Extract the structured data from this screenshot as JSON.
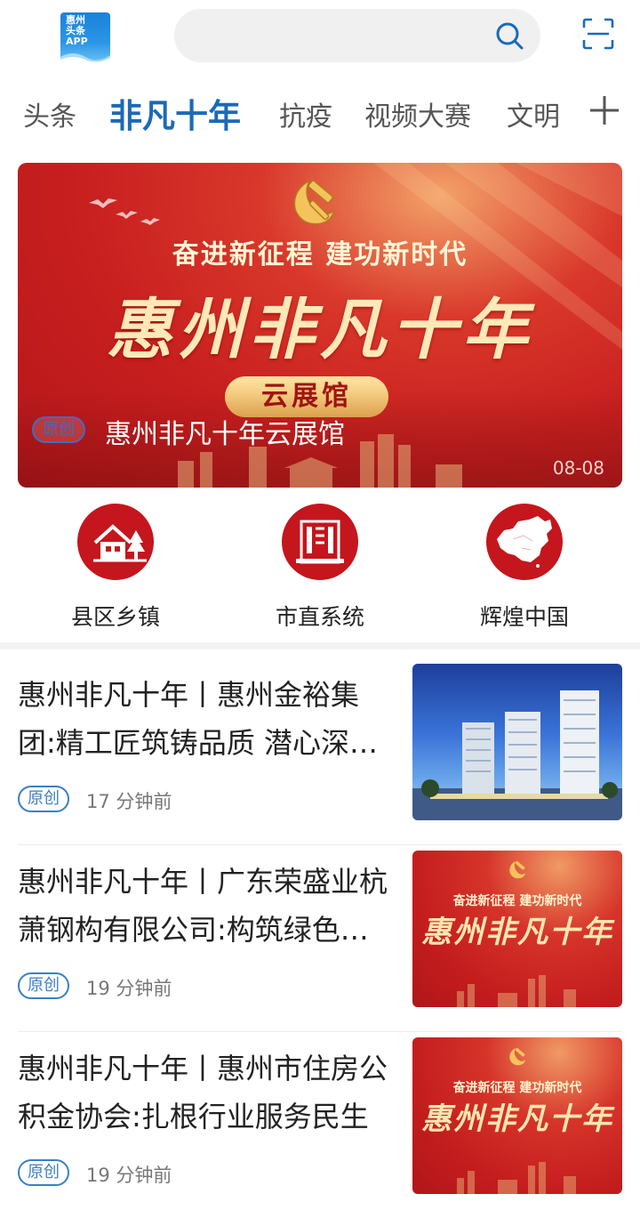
{
  "app": {
    "logo_text": [
      "惠州",
      "头条",
      "APP"
    ]
  },
  "search": {
    "placeholder": ""
  },
  "tabs": [
    "头条",
    "非凡十年",
    "抗疫",
    "视频大赛",
    "文明"
  ],
  "active_tab_index": 1,
  "banner": {
    "slogan": "奋进新征程  建功新时代",
    "calligraphy": "惠州非凡十年",
    "hall_label": "云展馆",
    "tag": "原创",
    "title": "惠州非凡十年云展馆",
    "date": "08-08"
  },
  "entries": [
    {
      "label": "县区乡镇",
      "icon": "house-tree-icon"
    },
    {
      "label": "市直系统",
      "icon": "building-icon"
    },
    {
      "label": "辉煌中国",
      "icon": "china-map-icon"
    }
  ],
  "news": [
    {
      "headline": "惠州非凡十年丨惠州金裕集团:精工匠筑铸品质 潜心深耕筑家园",
      "tag": "原创",
      "time": "17 分钟前",
      "thumb": "buildings"
    },
    {
      "headline": "惠州非凡十年丨广东荣盛业杭萧钢构有限公司:构筑绿色建筑未来",
      "tag": "原创",
      "time": "19 分钟前",
      "thumb": "poster"
    },
    {
      "headline": "惠州非凡十年丨惠州市住房公积金协会:扎根行业服务民生",
      "tag": "原创",
      "time": "19 分钟前",
      "thumb": "poster"
    }
  ],
  "thumb_poster": {
    "slogan": "奋进新征程  建功新时代",
    "calligraphy": "惠州非凡十年"
  },
  "colors": {
    "accent_blue": "#1a6ab8",
    "brand_red": "#c4161c",
    "tag_blue": "#3a7fc6"
  }
}
